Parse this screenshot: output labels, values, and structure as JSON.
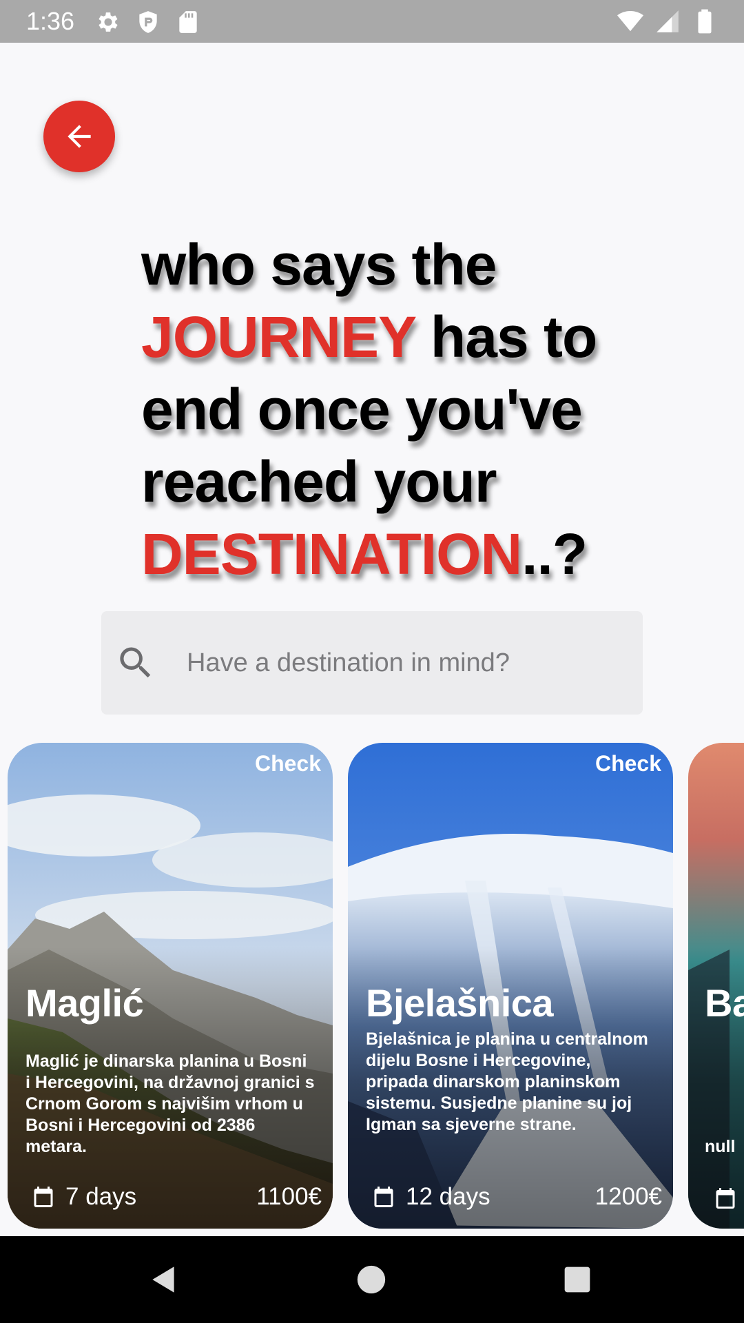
{
  "status_bar": {
    "time": "1:36",
    "icons": [
      "gear-icon",
      "shield-icon",
      "sd-card-icon",
      "wifi-icon",
      "signal-icon",
      "battery-icon"
    ]
  },
  "back_button": {
    "icon": "arrow-left-icon",
    "color": "#e0312a"
  },
  "headline": {
    "line1": "who says the",
    "journey": "JOURNEY",
    "line2_rest": " has to",
    "line3": "end once you've",
    "line4": "reached your",
    "destination": "DESTINATION",
    "end_punct": "..?",
    "accent_color": "#e0312a"
  },
  "search": {
    "placeholder": "Have a destination in mind?",
    "value": ""
  },
  "cards": [
    {
      "check_label": "Check",
      "title": "Maglić",
      "description": "Maglić je dinarska planina u Bosni i Hercegovini, na državnoj granici s Crnom Gorom s najvišim vrhom u Bosni i Hercegovini od 2386 metara.",
      "days": "7 days",
      "price": "1100€"
    },
    {
      "check_label": "Check",
      "title": "Bjelašnica",
      "description": "Bjelašnica je planina u centralnom dijelu Bosne i Hercegovine, pripada dinarskom planinskom sistemu. Susjedne planine su joj Igman sa sjeverne strane.",
      "days": "12 days",
      "price": "1200€"
    },
    {
      "title": "Ba",
      "description": "null"
    }
  ],
  "nav_bar": {
    "buttons": [
      "back-triangle-icon",
      "home-circle-icon",
      "recents-square-icon"
    ]
  }
}
